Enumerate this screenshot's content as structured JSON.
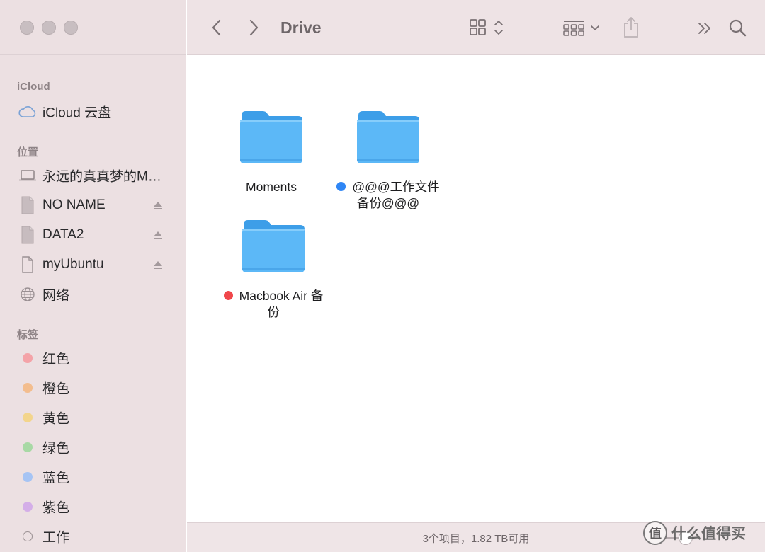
{
  "toolbar": {
    "title": "Drive",
    "back_icon": "chevron-left-icon",
    "forward_icon": "chevron-right-icon",
    "view_icon": "grid-view-icon",
    "group_icon": "group-by-icon",
    "share_icon": "share-icon",
    "overflow_icon": "double-chevron-icon",
    "search_icon": "search-icon"
  },
  "sidebar": {
    "sections": {
      "icloud": "iCloud",
      "locations": "位置",
      "tags": "标签"
    },
    "icloud_items": [
      {
        "label": "iCloud 云盘",
        "icon": "cloud-icon"
      }
    ],
    "location_items": [
      {
        "label": "永远的真真梦的MacBook Air",
        "icon": "laptop-icon",
        "eject": false
      },
      {
        "label": "NO NAME",
        "icon": "drive-icon",
        "eject": true
      },
      {
        "label": "DATA2",
        "icon": "drive-icon",
        "eject": true
      },
      {
        "label": "myUbuntu",
        "icon": "document-icon",
        "eject": true
      },
      {
        "label": "网络",
        "icon": "network-globe-icon",
        "eject": false
      }
    ],
    "tag_items": [
      {
        "label": "红色",
        "color": "#f4a3a8"
      },
      {
        "label": "橙色",
        "color": "#f3bd8e"
      },
      {
        "label": "黄色",
        "color": "#f3d58c"
      },
      {
        "label": "绿色",
        "color": "#a8d9a5"
      },
      {
        "label": "蓝色",
        "color": "#a6c4f4"
      },
      {
        "label": "紫色",
        "color": "#d4aee8"
      },
      {
        "label": "工作",
        "color": ""
      }
    ]
  },
  "folders": [
    {
      "name": "Moments",
      "tag_color": ""
    },
    {
      "name": "@@@工作文件备份@@@",
      "tag_color": "#2f86f5"
    },
    {
      "name": "Macbook Air 备份",
      "tag_color": "#f0474b"
    }
  ],
  "status": {
    "text": "3个项目，1.82 TB可用"
  },
  "watermark": {
    "text": "什么值得买",
    "badge": "值"
  },
  "colors": {
    "folder_blue": "#5cb8f7",
    "folder_tab": "#3d9ee8",
    "sidebar_bg": "#ece0e2"
  }
}
